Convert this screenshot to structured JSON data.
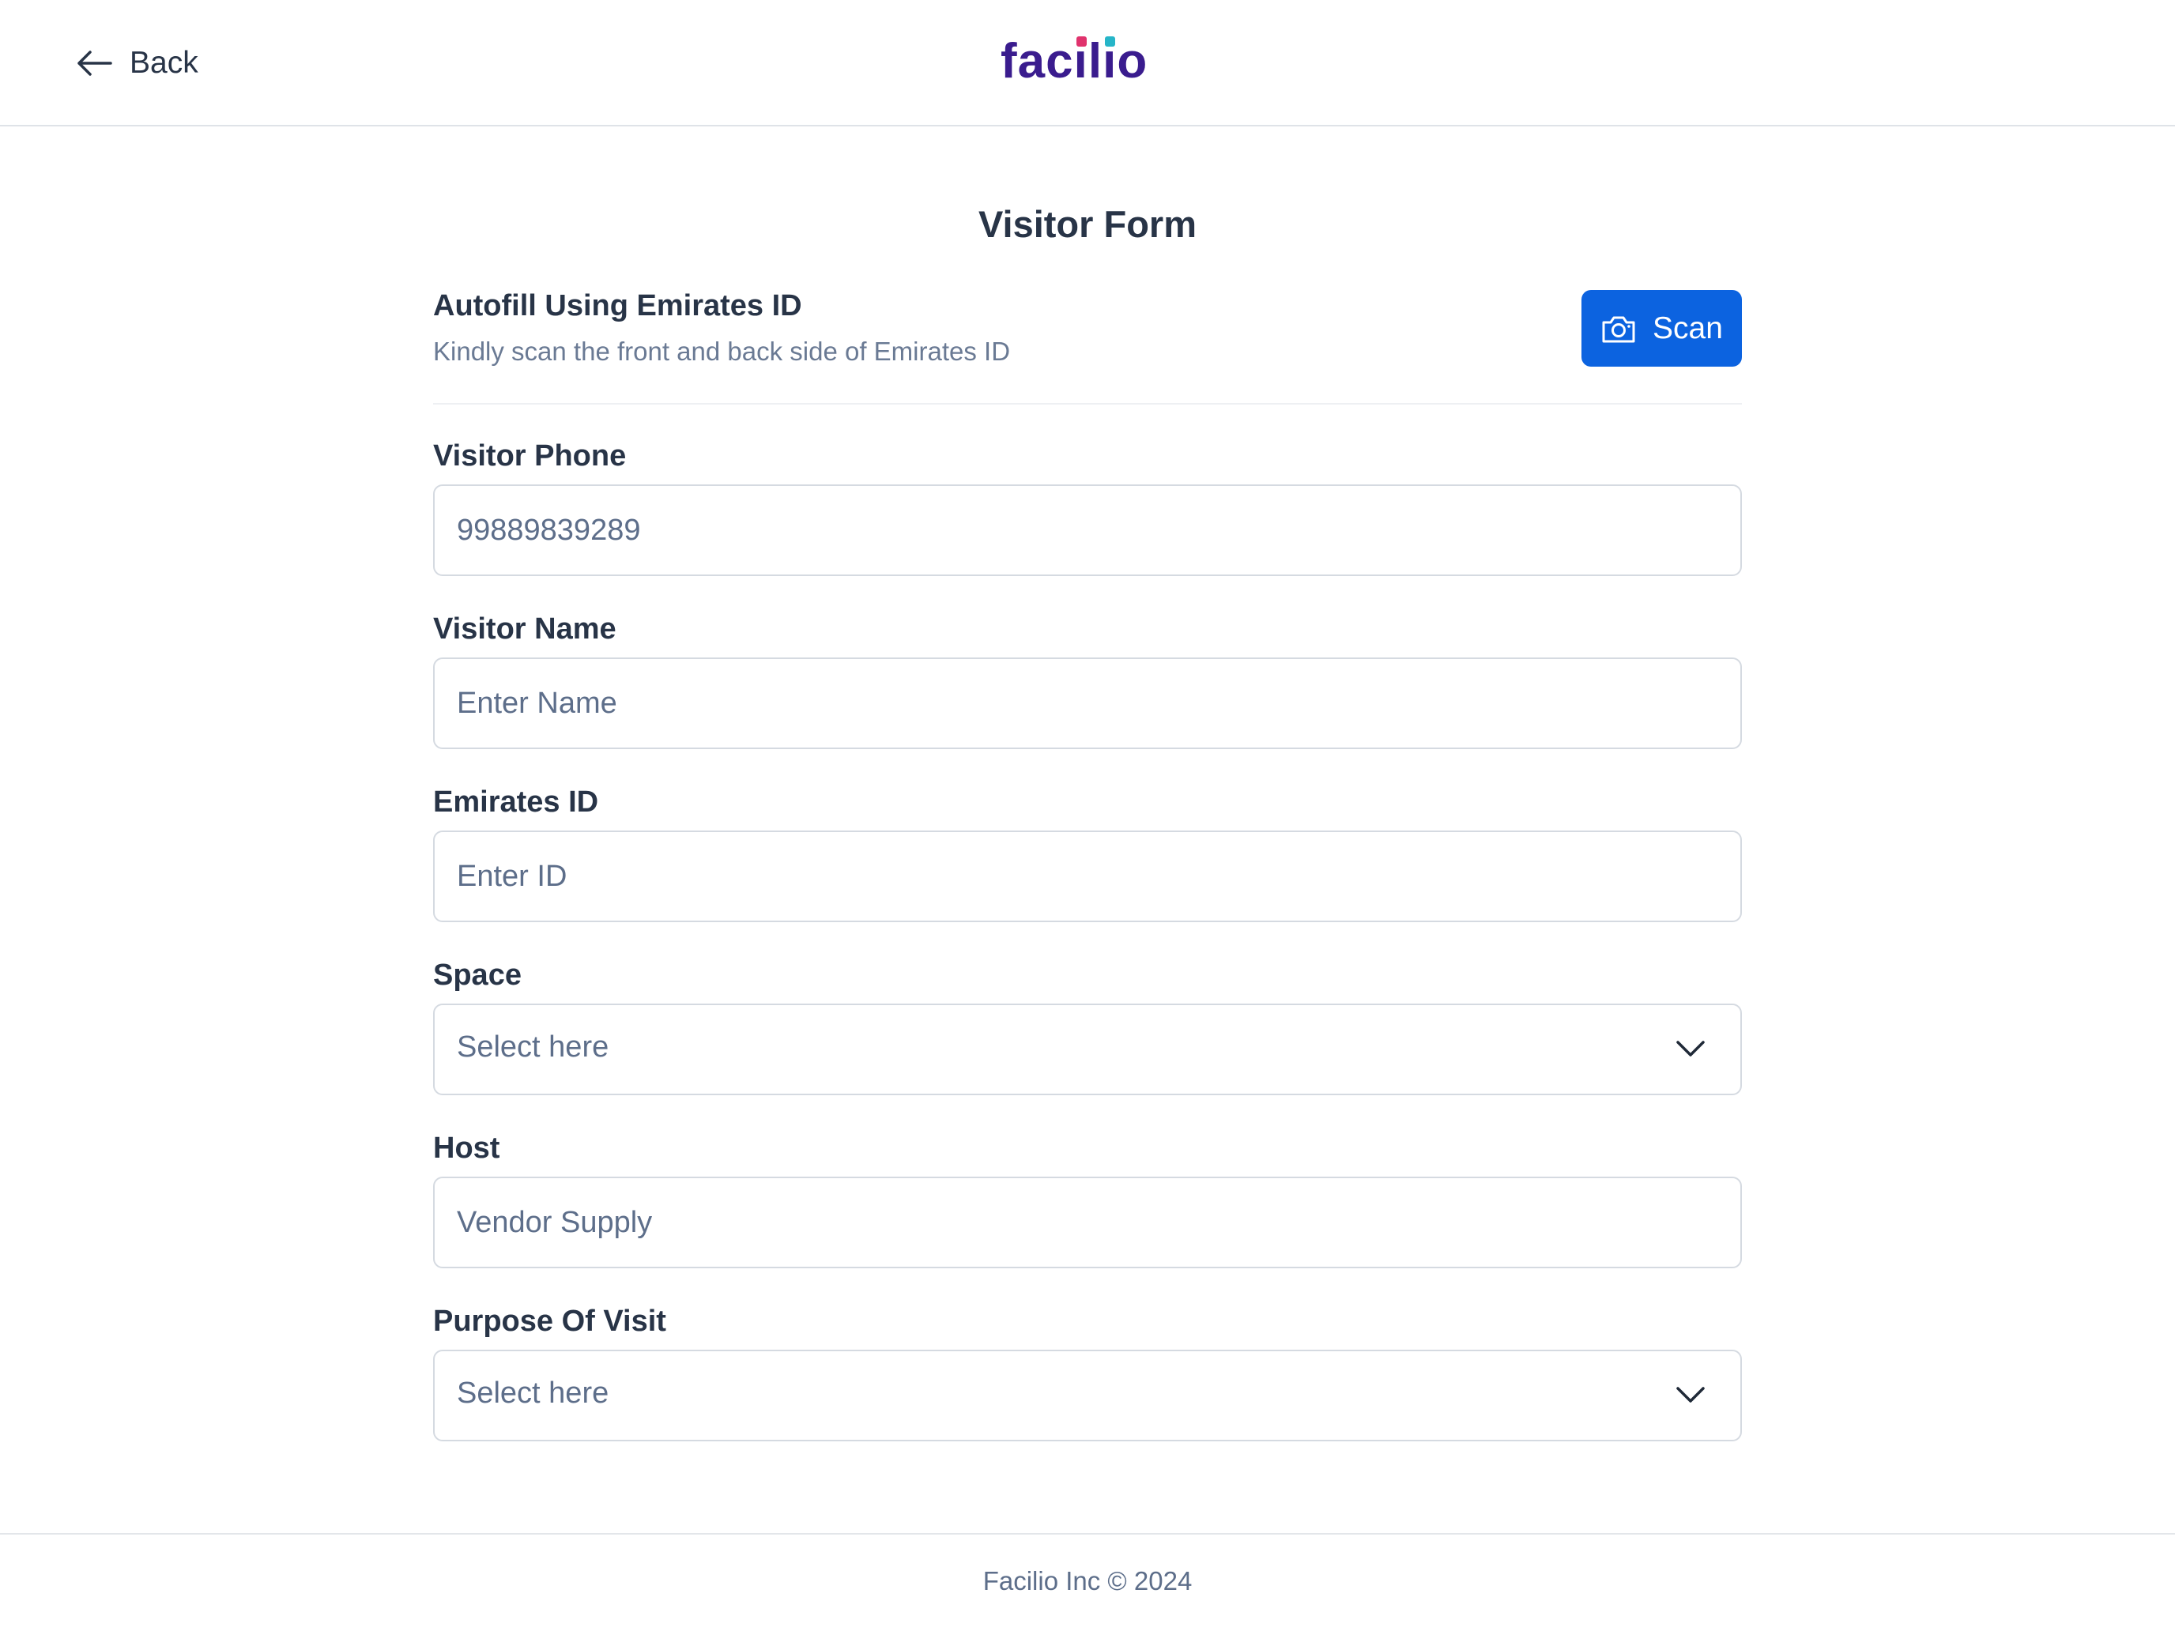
{
  "header": {
    "back_label": "Back",
    "logo_text": {
      "f": "fac",
      "i1": "i",
      "l": "l",
      "i2": "i",
      "o": "o"
    }
  },
  "form": {
    "title": "Visitor Form",
    "autofill": {
      "heading": "Autofill Using Emirates ID",
      "subtext": "Kindly scan the front and back side of Emirates ID",
      "scan_label": "Scan"
    },
    "fields": {
      "visitor_phone": {
        "label": "Visitor Phone",
        "value": "99889839289",
        "placeholder": ""
      },
      "visitor_name": {
        "label": "Visitor Name",
        "value": "",
        "placeholder": "Enter Name"
      },
      "emirates_id": {
        "label": "Emirates ID",
        "value": "",
        "placeholder": "Enter ID"
      },
      "space": {
        "label": "Space",
        "selected": "Select here"
      },
      "host": {
        "label": "Host",
        "value": "Vendor Supply",
        "placeholder": ""
      },
      "purpose_of_visit": {
        "label": "Purpose Of Visit",
        "selected": "Select here"
      }
    }
  },
  "footer": {
    "copyright": "Facilio Inc © 2024"
  },
  "colors": {
    "accent": "#0c63e0",
    "logo": "#3a1c8e",
    "logo_dot_teal": "#26b5c8",
    "logo_dot_pink": "#e0336d",
    "text": "#283447",
    "muted": "#5d6e8a"
  }
}
